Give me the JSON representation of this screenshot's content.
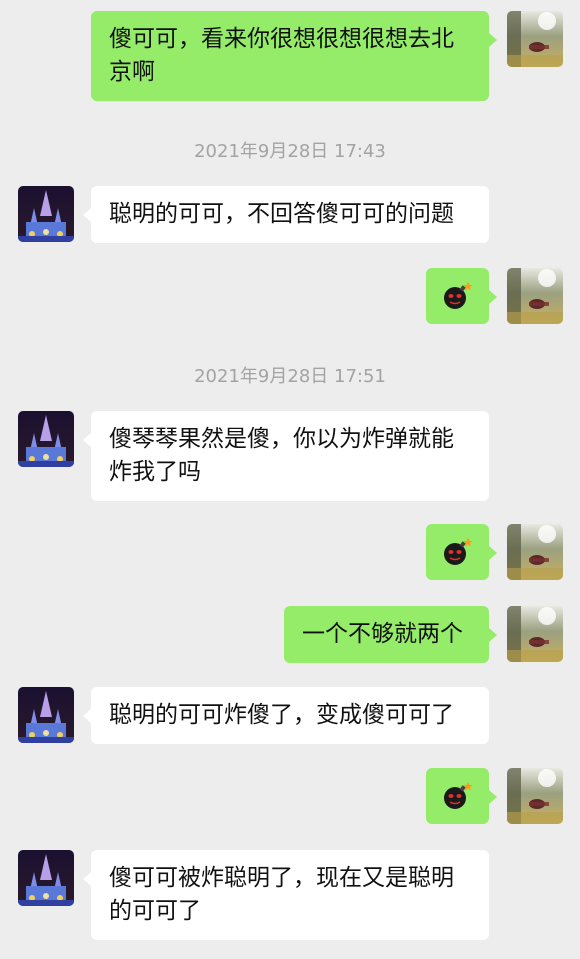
{
  "timestamps": [
    "2021年9月28日 17:43",
    "2021年9月28日 17:51"
  ],
  "icons": {
    "self_avatar": "park-photo-avatar",
    "other_avatar": "castle-night-avatar",
    "sticker": "bomb-emoji-icon"
  },
  "messages": [
    {
      "side": "right",
      "type": "text",
      "text": "傻可可，看来你很想很想很想去北京啊"
    },
    {
      "side": "left",
      "type": "text",
      "text": "聪明的可可，不回答傻可可的问题"
    },
    {
      "side": "right",
      "type": "emoji",
      "icon": "bomb"
    },
    {
      "side": "left",
      "type": "text",
      "text": "傻琴琴果然是傻，你以为炸弹就能炸我了吗"
    },
    {
      "side": "right",
      "type": "emoji",
      "icon": "bomb"
    },
    {
      "side": "right",
      "type": "text",
      "text": "一个不够就两个"
    },
    {
      "side": "left",
      "type": "text",
      "text": "聪明的可可炸傻了，变成傻可可了"
    },
    {
      "side": "right",
      "type": "emoji",
      "icon": "bomb"
    },
    {
      "side": "left",
      "type": "text",
      "text": "傻可可被炸聪明了，现在又是聪明的可可了"
    }
  ],
  "colors": {
    "background": "#ededed",
    "outgoing_bubble": "#95ec69",
    "incoming_bubble": "#ffffff",
    "timestamp": "#a3a3a3"
  }
}
